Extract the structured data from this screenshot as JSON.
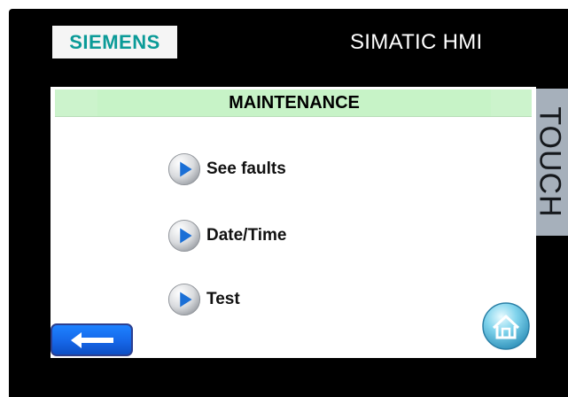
{
  "brand": {
    "logo_text": "SIEMENS",
    "logo_color": "#0b9b98"
  },
  "header": {
    "title": "SIMATIC HMI"
  },
  "side_label": "TOUCH",
  "screen": {
    "title": "MAINTENANCE",
    "title_bar_color": "#ccf3cc"
  },
  "menu": [
    {
      "label": "See faults",
      "icon": "play-arrow-icon"
    },
    {
      "label": "Date/Time",
      "icon": "play-arrow-icon"
    },
    {
      "label": "Test",
      "icon": "play-arrow-icon"
    }
  ],
  "navigation": {
    "back_icon": "arrow-left-icon",
    "home_icon": "home-icon",
    "back_color": "#1667e8"
  }
}
